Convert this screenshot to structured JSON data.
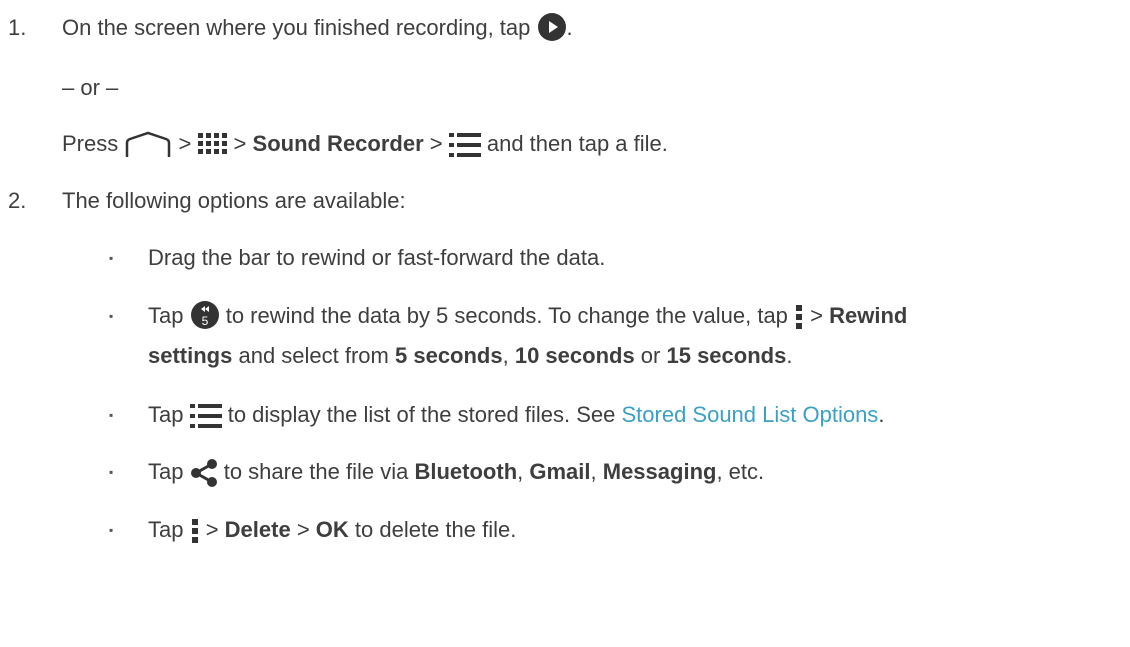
{
  "steps": {
    "s1": {
      "num": "1.",
      "pre": "On the screen where you finished recording, tap ",
      "post": "."
    },
    "or": "– or –",
    "press": {
      "press": "Press ",
      "gt1": " > ",
      "gt2": " > ",
      "app": "Sound Recorder",
      "gt3": " > ",
      "post": " and then tap a file."
    },
    "s2": {
      "num": "2.",
      "text": "The following options are available:"
    }
  },
  "bullets": {
    "b1": {
      "text": "Drag the bar to rewind or fast-forward the data."
    },
    "b2": {
      "tap": "Tap ",
      "mid": " to rewind the data by 5 seconds. To change the value, tap ",
      "gt": " > ",
      "rewind": "Rewind",
      "settings": "settings",
      "select": " and select from ",
      "opt1": "5 seconds",
      "comma": ", ",
      "opt2": "10 seconds",
      "or": " or ",
      "opt3": "15 seconds",
      "dot": ".",
      "rewind_icon_label": "5"
    },
    "b3": {
      "tap": "Tap ",
      "mid": " to display the list of the stored files. See ",
      "link": "Stored Sound List Options",
      "dot": "."
    },
    "b4": {
      "tap": "Tap ",
      "mid": " to share the file via ",
      "bt": "Bluetooth",
      "c1": ", ",
      "gmail": "Gmail",
      "c2": ", ",
      "msg": "Messaging",
      "end": ", etc."
    },
    "b5": {
      "tap": "Tap ",
      "gt1": " > ",
      "del": "Delete",
      "gt2": " > ",
      "ok": "OK",
      "end": " to delete the file."
    }
  },
  "bullet_char": "▪",
  "icons": {
    "play": "play-button-icon",
    "home": "home-icon",
    "apps": "apps-grid-icon",
    "list": "list-icon",
    "rewind": "rewind-5-icon",
    "menu": "menu-icon",
    "share": "share-icon"
  },
  "colors": {
    "text": "#3e3e3e",
    "link": "#3aa0c4",
    "icon": "#333333"
  }
}
